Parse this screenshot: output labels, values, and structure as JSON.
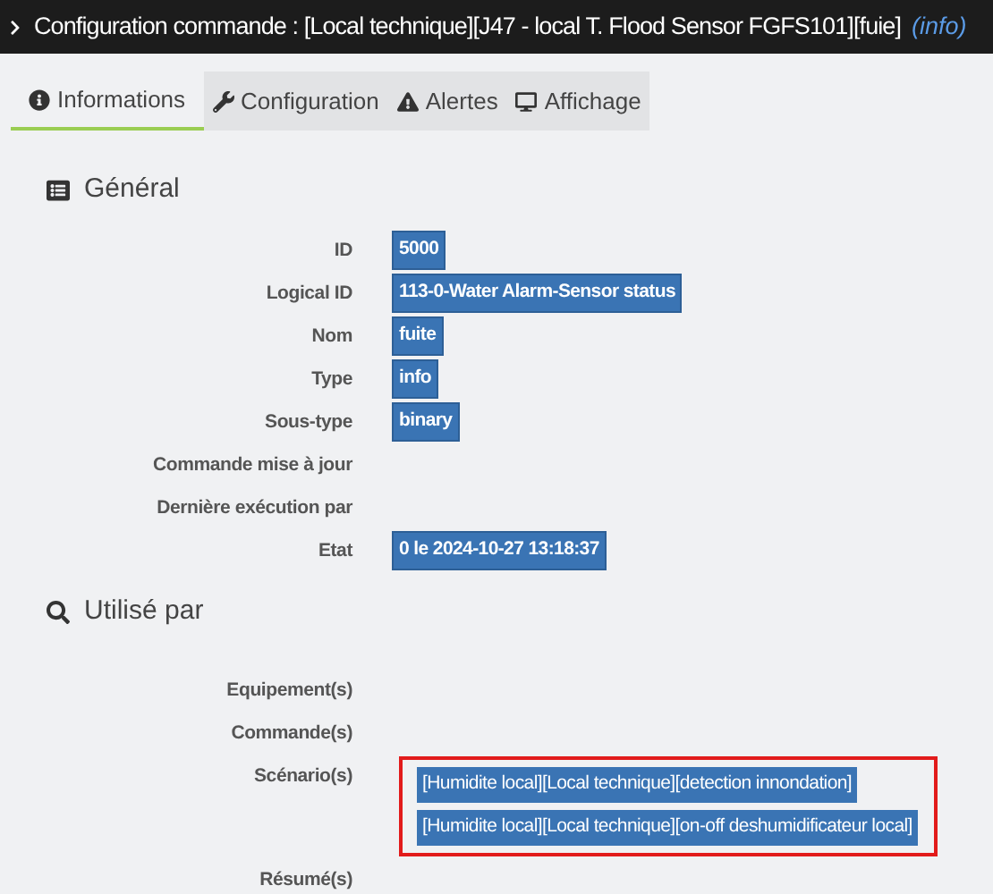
{
  "window": {
    "title": "Configuration commande : [Local technique][J47 - local T. Flood Sensor FGFS101][fuie]",
    "suffix": "(info)"
  },
  "tabs": [
    {
      "label": "Informations",
      "kind": "info",
      "selected": true
    },
    {
      "label": "Configuration",
      "kind": "wrench",
      "selected": false
    },
    {
      "label": "Alertes",
      "kind": "warning",
      "selected": false
    },
    {
      "label": "Affichage",
      "kind": "monitor",
      "selected": false
    }
  ],
  "sections": [
    {
      "heading": "Général",
      "kind": "list",
      "rows": [
        {
          "label": "ID",
          "values": [
            "5000"
          ],
          "highlighted": false
        },
        {
          "label": "Logical ID",
          "values": [
            "113-0-Water Alarm-Sensor status"
          ],
          "highlighted": false
        },
        {
          "label": "Nom",
          "values": [
            "fuite"
          ],
          "highlighted": false
        },
        {
          "label": "Type",
          "values": [
            "info"
          ],
          "highlighted": false
        },
        {
          "label": "Sous-type",
          "values": [
            "binary"
          ],
          "highlighted": false
        },
        {
          "label": "Commande mise à jour",
          "values": [],
          "highlighted": false
        },
        {
          "label": "Dernière exécution par",
          "values": [],
          "highlighted": false
        },
        {
          "label": "Etat",
          "values": [
            "0 le 2024-10-27 13:18:37"
          ],
          "highlighted": false
        }
      ]
    },
    {
      "heading": "Utilisé par",
      "kind": "search",
      "rows": [
        {
          "label": "Equipement(s)",
          "values": [],
          "highlighted": false
        },
        {
          "label": "Commande(s)",
          "values": [],
          "highlighted": false
        },
        {
          "label": "Scénario(s)",
          "values": [
            "[Humidite local][Local technique][detection innondation]",
            "[Humidite local][Local technique][on-off deshumidificateur local]"
          ],
          "highlighted": true
        },
        {
          "label": "Résumé(s)",
          "values": [],
          "highlighted": false
        }
      ]
    }
  ]
}
